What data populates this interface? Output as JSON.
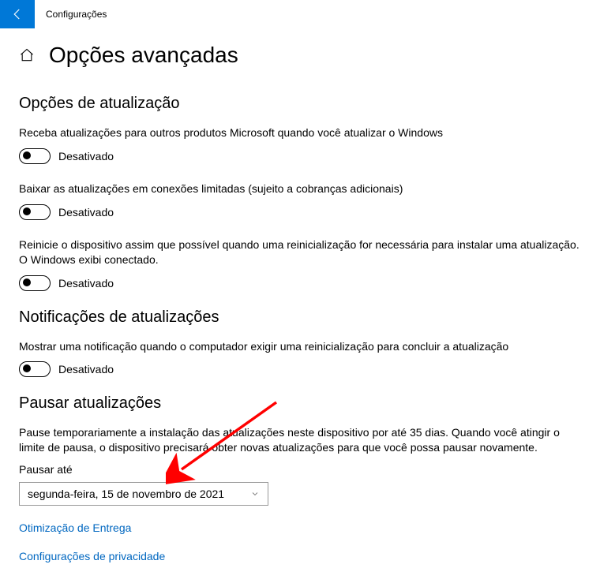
{
  "titlebar": {
    "title": "Configurações"
  },
  "page": {
    "title": "Opções avançadas"
  },
  "sections": {
    "updateOptions": {
      "title": "Opções de atualização",
      "items": [
        {
          "text": "Receba atualizações para outros produtos Microsoft quando você atualizar o Windows",
          "state": "Desativado"
        },
        {
          "text": "Baixar as atualizações em conexões limitadas (sujeito a cobranças adicionais)",
          "state": "Desativado"
        },
        {
          "text": "Reinicie o dispositivo assim que possível quando uma reinicialização for necessária para instalar uma atualização. O Windows exibi conectado.",
          "state": "Desativado"
        }
      ]
    },
    "notifications": {
      "title": "Notificações de atualizações",
      "items": [
        {
          "text": "Mostrar uma notificação quando o computador exigir uma reinicialização para concluir a atualização",
          "state": "Desativado"
        }
      ]
    },
    "pause": {
      "title": "Pausar atualizações",
      "description": "Pause temporariamente a instalação das atualizações neste dispositivo por até 35 dias. Quando você atingir o limite de pausa, o dispositivo precisará obter novas atualizações para que você possa pausar novamente.",
      "fieldLabel": "Pausar até",
      "selectedValue": "segunda-feira, 15 de novembro de 2021"
    }
  },
  "links": {
    "delivery": "Otimização de Entrega",
    "privacy": "Configurações de privacidade"
  }
}
